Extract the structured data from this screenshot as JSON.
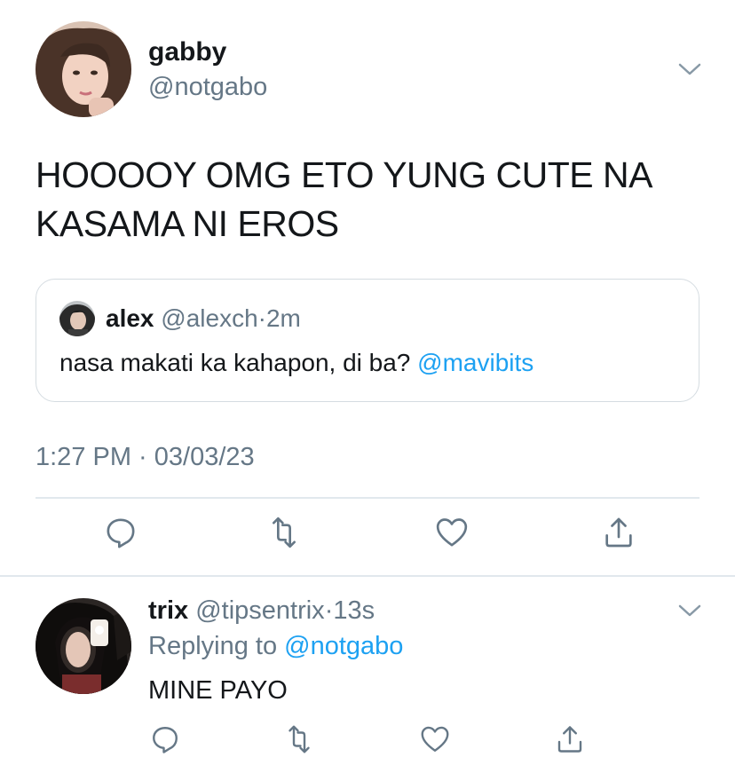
{
  "main_tweet": {
    "display_name": "gabby",
    "handle": "@notgabo",
    "text": "HOOOOY OMG ETO YUNG CUTE NA KASAMA NI EROS",
    "quoted": {
      "display_name": "alex",
      "handle": "@alexch",
      "separator": "·",
      "time": "2m",
      "text": "nasa makati ka kahapon, di ba?",
      "mention": "@mavibits"
    },
    "timestamp": "1:27 PM · 03/03/23",
    "actions": [
      "reply-icon",
      "retweet-icon",
      "like-icon",
      "share-icon"
    ]
  },
  "reply": {
    "display_name": "trix",
    "handle": "@tipsentrix",
    "separator": "·",
    "time": "13s",
    "replying_prefix": "Replying to",
    "replying_handle": "@notgabo",
    "text": "MINE PAYO",
    "actions": [
      "reply-icon",
      "retweet-icon",
      "like-icon",
      "share-icon"
    ]
  },
  "colors": {
    "text": "#14171a",
    "secondary": "#657786",
    "link": "#1da1f2",
    "border": "#e1e8ed"
  }
}
